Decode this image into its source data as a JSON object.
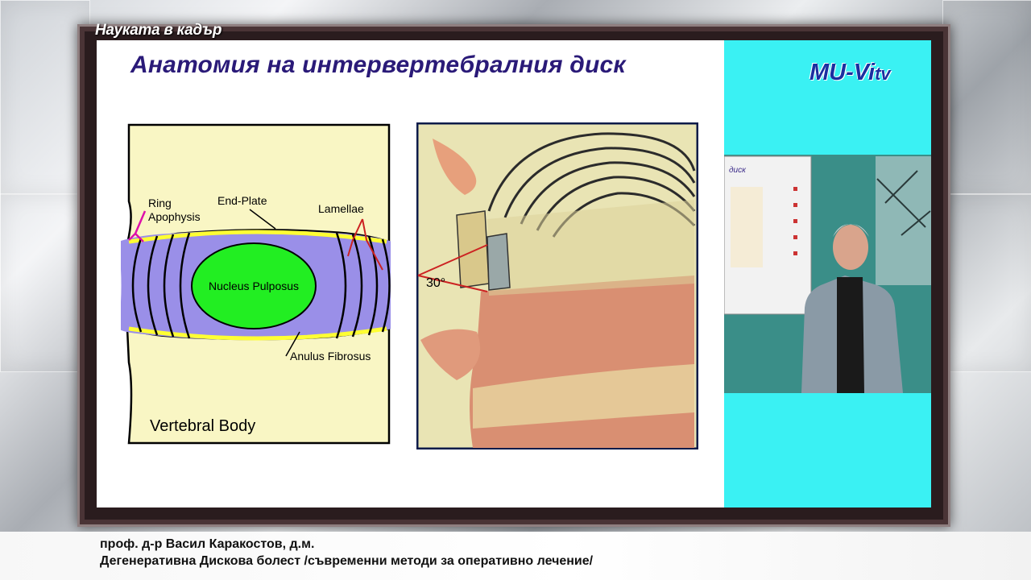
{
  "brand": "Науката в кадър",
  "slide": {
    "title": "Анатомия на интервертебралния диск",
    "labels": {
      "ring": "Ring",
      "apophysis": "Apophysis",
      "end_plate": "End-Plate",
      "lamellae": "Lamellae",
      "nucleus": "Nucleus Pulposus",
      "anulus": "Anulus Fibrosus",
      "vertebral_body": "Vertebral Body",
      "angle": "30°"
    }
  },
  "logo": {
    "main": "MU-Vi",
    "suffix": "tv"
  },
  "video": {
    "board_text": "диск"
  },
  "lower_third": {
    "name": "проф. д-р Васил Каракостов, д.м.",
    "topic": "Дегенеративна Дискова болест /съвременни методи за оперативно лечение/"
  },
  "colors": {
    "title": "#2a1a78",
    "disc": "#9a8fe8",
    "nucleus": "#22ee22",
    "bone": "#f9f6c4",
    "end_plate": "#ffff33",
    "annotation": "#cc2222",
    "side_panel": "#3af1f3"
  }
}
